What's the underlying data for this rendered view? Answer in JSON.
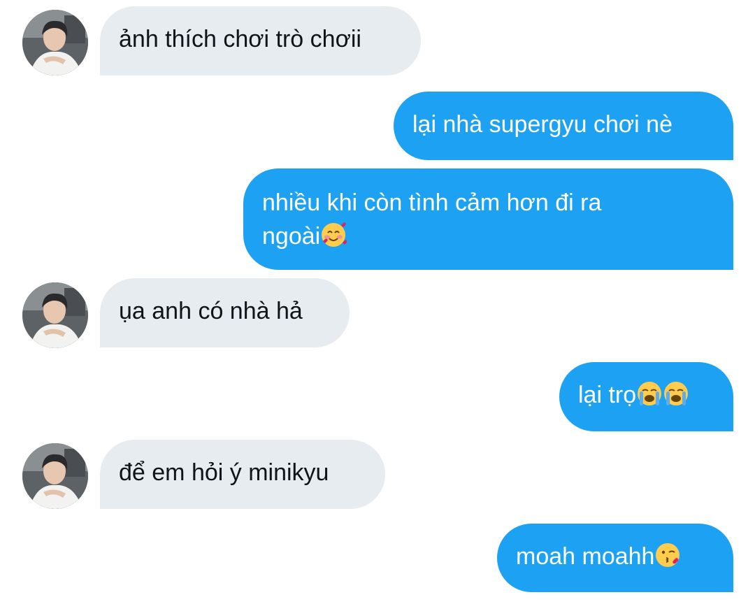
{
  "messages": [
    {
      "direction": "incoming",
      "text": "ảnh thích chơi trò chơii",
      "avatar": "profile-photo"
    },
    {
      "direction": "outgoing",
      "text": "lại nhà supergyu chơi nè"
    },
    {
      "direction": "outgoing",
      "line1": "nhiều khi còn tình cảm hơn đi ra",
      "line2": "ngoài",
      "emoji": "smiling-face-with-hearts"
    },
    {
      "direction": "incoming",
      "text": "ụa anh có nhà hả",
      "avatar": "profile-photo"
    },
    {
      "direction": "outgoing",
      "text": "lại trọ",
      "emoji": [
        "loudly-crying-face",
        "loudly-crying-face"
      ]
    },
    {
      "direction": "incoming",
      "text": "để em hỏi ý minikyu",
      "avatar": "profile-photo"
    },
    {
      "direction": "outgoing",
      "text": "moah moahh",
      "emoji": "face-blowing-a-kiss"
    }
  ],
  "colors": {
    "incoming_bubble": "#e7ecf0",
    "incoming_text": "#0f1419",
    "outgoing_bubble": "#1da1f2",
    "outgoing_text": "#ffffff",
    "background": "#ffffff"
  }
}
